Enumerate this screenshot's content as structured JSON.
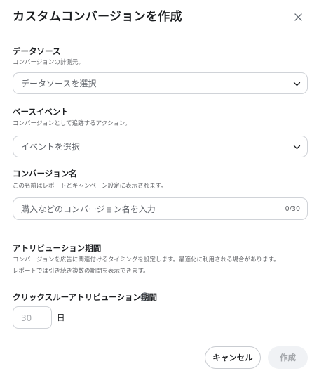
{
  "dialog": {
    "title": "カスタムコンバージョンを作成",
    "close_icon": "close-icon"
  },
  "data_source": {
    "label": "データソース",
    "hint": "コンバージョンの計測元。",
    "placeholder": "データソースを選択"
  },
  "base_event": {
    "label": "ベースイベント",
    "hint": "コンバージョンとして追跡するアクション。",
    "placeholder": "イベントを選択"
  },
  "conversion_name": {
    "label": "コンバージョン名",
    "hint": "この名前はレポートとキャンペーン設定に表示されます。",
    "placeholder": "購入などのコンバージョン名を入力",
    "counter": "0/30"
  },
  "attribution": {
    "label": "アトリビューション期間",
    "hint_line1": "コンバージョンを広告に関連付けるタイミングを設定します。最適化に利用される場合があります。",
    "hint_line2": "レポートでは引き続き複数の期間を表示できます。"
  },
  "click_through": {
    "label": "クリックスルーアトリビューション期間",
    "info_icon": "info-icon",
    "value": "30",
    "unit": "日"
  },
  "footer": {
    "cancel_label": "キャンセル",
    "create_label": "作成"
  }
}
